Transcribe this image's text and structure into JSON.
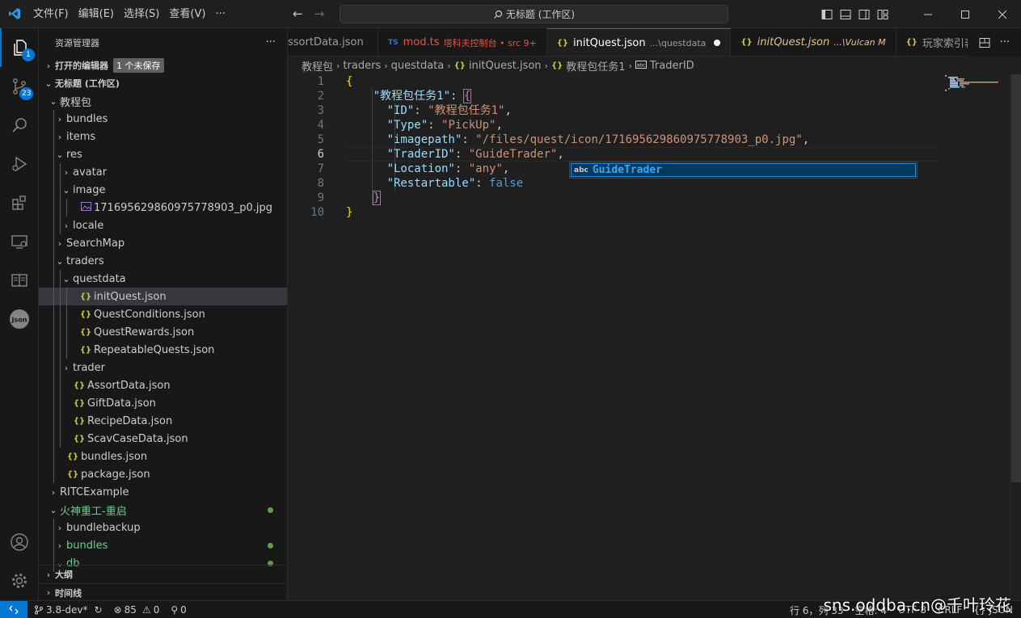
{
  "titlebar": {
    "menu": [
      "文件(F)",
      "编辑(E)",
      "选择(S)",
      "查看(V)",
      "···"
    ],
    "search_text": "无标题 (工作区)"
  },
  "activity": {
    "explorer_badge": "1",
    "scm_badge": "23"
  },
  "sidebar": {
    "title": "资源管理器",
    "more": "···",
    "open_editors": "打开的编辑器",
    "unsaved": "1 个未保存",
    "workspace": "无标题 (工作区)",
    "tree": [
      {
        "label": "教程包",
        "level": 0,
        "twisty": "down",
        "icon": ""
      },
      {
        "label": "bundles",
        "level": 1,
        "twisty": "right",
        "icon": ""
      },
      {
        "label": "items",
        "level": 1,
        "twisty": "right",
        "icon": ""
      },
      {
        "label": "res",
        "level": 1,
        "twisty": "down",
        "icon": ""
      },
      {
        "label": "avatar",
        "level": 2,
        "twisty": "right",
        "icon": ""
      },
      {
        "label": "image",
        "level": 2,
        "twisty": "down",
        "icon": ""
      },
      {
        "label": "171695629860975778903_p0.jpg",
        "level": 3,
        "twisty": "",
        "icon": "img"
      },
      {
        "label": "locale",
        "level": 2,
        "twisty": "right",
        "icon": ""
      },
      {
        "label": "SearchMap",
        "level": 1,
        "twisty": "right",
        "icon": ""
      },
      {
        "label": "traders",
        "level": 1,
        "twisty": "down",
        "icon": ""
      },
      {
        "label": "questdata",
        "level": 2,
        "twisty": "down",
        "icon": ""
      },
      {
        "label": "initQuest.json",
        "level": 3,
        "twisty": "",
        "icon": "json",
        "selected": true
      },
      {
        "label": "QuestConditions.json",
        "level": 3,
        "twisty": "",
        "icon": "json"
      },
      {
        "label": "QuestRewards.json",
        "level": 3,
        "twisty": "",
        "icon": "json"
      },
      {
        "label": "RepeatableQuests.json",
        "level": 3,
        "twisty": "",
        "icon": "json"
      },
      {
        "label": "trader",
        "level": 2,
        "twisty": "right",
        "icon": ""
      },
      {
        "label": "AssortData.json",
        "level": 2,
        "twisty": "",
        "icon": "json"
      },
      {
        "label": "GiftData.json",
        "level": 2,
        "twisty": "",
        "icon": "json"
      },
      {
        "label": "RecipeData.json",
        "level": 2,
        "twisty": "",
        "icon": "json"
      },
      {
        "label": "ScavCaseData.json",
        "level": 2,
        "twisty": "",
        "icon": "json"
      },
      {
        "label": "bundles.json",
        "level": 1,
        "twisty": "",
        "icon": "json"
      },
      {
        "label": "package.json",
        "level": 1,
        "twisty": "",
        "icon": "json"
      },
      {
        "label": "RITCExample",
        "level": 0,
        "twisty": "right",
        "icon": ""
      },
      {
        "label": "火神重工-重启",
        "level": 0,
        "twisty": "down",
        "icon": "",
        "git": true,
        "dot": true
      },
      {
        "label": "bundlebackup",
        "level": 1,
        "twisty": "right",
        "icon": ""
      },
      {
        "label": "bundles",
        "level": 1,
        "twisty": "right",
        "icon": "",
        "git": true,
        "dot": true
      },
      {
        "label": "db",
        "level": 1,
        "twisty": "down",
        "icon": "",
        "git": true,
        "dot": true
      }
    ],
    "outline": "大纲",
    "timeline": "时间线"
  },
  "tabs": [
    {
      "label": "ssortData.json",
      "icon": "",
      "desc": "",
      "active": false
    },
    {
      "label": "mod.ts",
      "icon": "TS",
      "desc": "塔科夫控制台 • src 9+",
      "active": false,
      "error": true
    },
    {
      "label": "initQuest.json",
      "icon": "{}",
      "desc": "...\\questdata",
      "active": true,
      "modified": true
    },
    {
      "label": "initQuest.json",
      "icon": "{}",
      "desc": "...\\Vulcan M",
      "active": false,
      "italic": true
    },
    {
      "label": "玩家索引表",
      "icon": "{}",
      "desc": "",
      "active": false
    }
  ],
  "breadcrumbs": [
    "教程包",
    "traders",
    "questdata",
    "initQuest.json",
    "教程包任务1",
    "TraderID"
  ],
  "editor": {
    "line_numbers": [
      "1",
      "2",
      "3",
      "4",
      "5",
      "6",
      "7",
      "8",
      "9",
      "10"
    ],
    "current_line": "6",
    "lines": [
      [
        {
          "t": "{",
          "c": "br1"
        }
      ],
      [
        {
          "t": "    ",
          "c": ""
        },
        {
          "t": "\"教程包任务1\"",
          "c": "k"
        },
        {
          "t": ": ",
          "c": ""
        },
        {
          "t": "{",
          "c": "br2"
        }
      ],
      [
        {
          "t": "      ",
          "c": ""
        },
        {
          "t": "\"ID\"",
          "c": "k"
        },
        {
          "t": ": ",
          "c": ""
        },
        {
          "t": "\"教程包任务1\"",
          "c": "s"
        },
        {
          "t": ",",
          "c": ""
        }
      ],
      [
        {
          "t": "      ",
          "c": ""
        },
        {
          "t": "\"Type\"",
          "c": "k"
        },
        {
          "t": ": ",
          "c": ""
        },
        {
          "t": "\"PickUp\"",
          "c": "s"
        },
        {
          "t": ",",
          "c": ""
        }
      ],
      [
        {
          "t": "      ",
          "c": ""
        },
        {
          "t": "\"imagepath\"",
          "c": "k"
        },
        {
          "t": ": ",
          "c": ""
        },
        {
          "t": "\"/files/quest/icon/171695629860975778903_p0.jpg\"",
          "c": "s"
        },
        {
          "t": ",",
          "c": ""
        }
      ],
      [
        {
          "t": "      ",
          "c": ""
        },
        {
          "t": "\"TraderID\"",
          "c": "k"
        },
        {
          "t": ": ",
          "c": ""
        },
        {
          "t": "\"GuideTrader\"",
          "c": "s"
        },
        {
          "t": ",",
          "c": ""
        }
      ],
      [
        {
          "t": "      ",
          "c": ""
        },
        {
          "t": "\"Location\"",
          "c": "k"
        },
        {
          "t": ": ",
          "c": ""
        },
        {
          "t": "\"any\"",
          "c": "s"
        },
        {
          "t": ",",
          "c": ""
        }
      ],
      [
        {
          "t": "      ",
          "c": ""
        },
        {
          "t": "\"Restartable\"",
          "c": "k"
        },
        {
          "t": ": ",
          "c": ""
        },
        {
          "t": "false",
          "c": "b"
        }
      ],
      [
        {
          "t": "    ",
          "c": ""
        },
        {
          "t": "}",
          "c": "br2"
        }
      ],
      [
        {
          "t": "}",
          "c": "br1"
        }
      ]
    ],
    "suggestion": {
      "kind": "abc",
      "label": "GuideTrader"
    }
  },
  "status": {
    "branch": "3.8-dev*",
    "errors": "85",
    "warnings": "0",
    "ports": "0",
    "position": "行 6，列 33",
    "indent": "空格: 4",
    "encoding": "UTF-8",
    "eol": "CRLF",
    "language": "{} JSON"
  },
  "watermark": "sns.oddba.cn@千叶玲花",
  "colors": {
    "accent": "#0078d4",
    "selection": "#37373d",
    "git_added": "#73c991",
    "json_icon": "#cbcb41"
  }
}
